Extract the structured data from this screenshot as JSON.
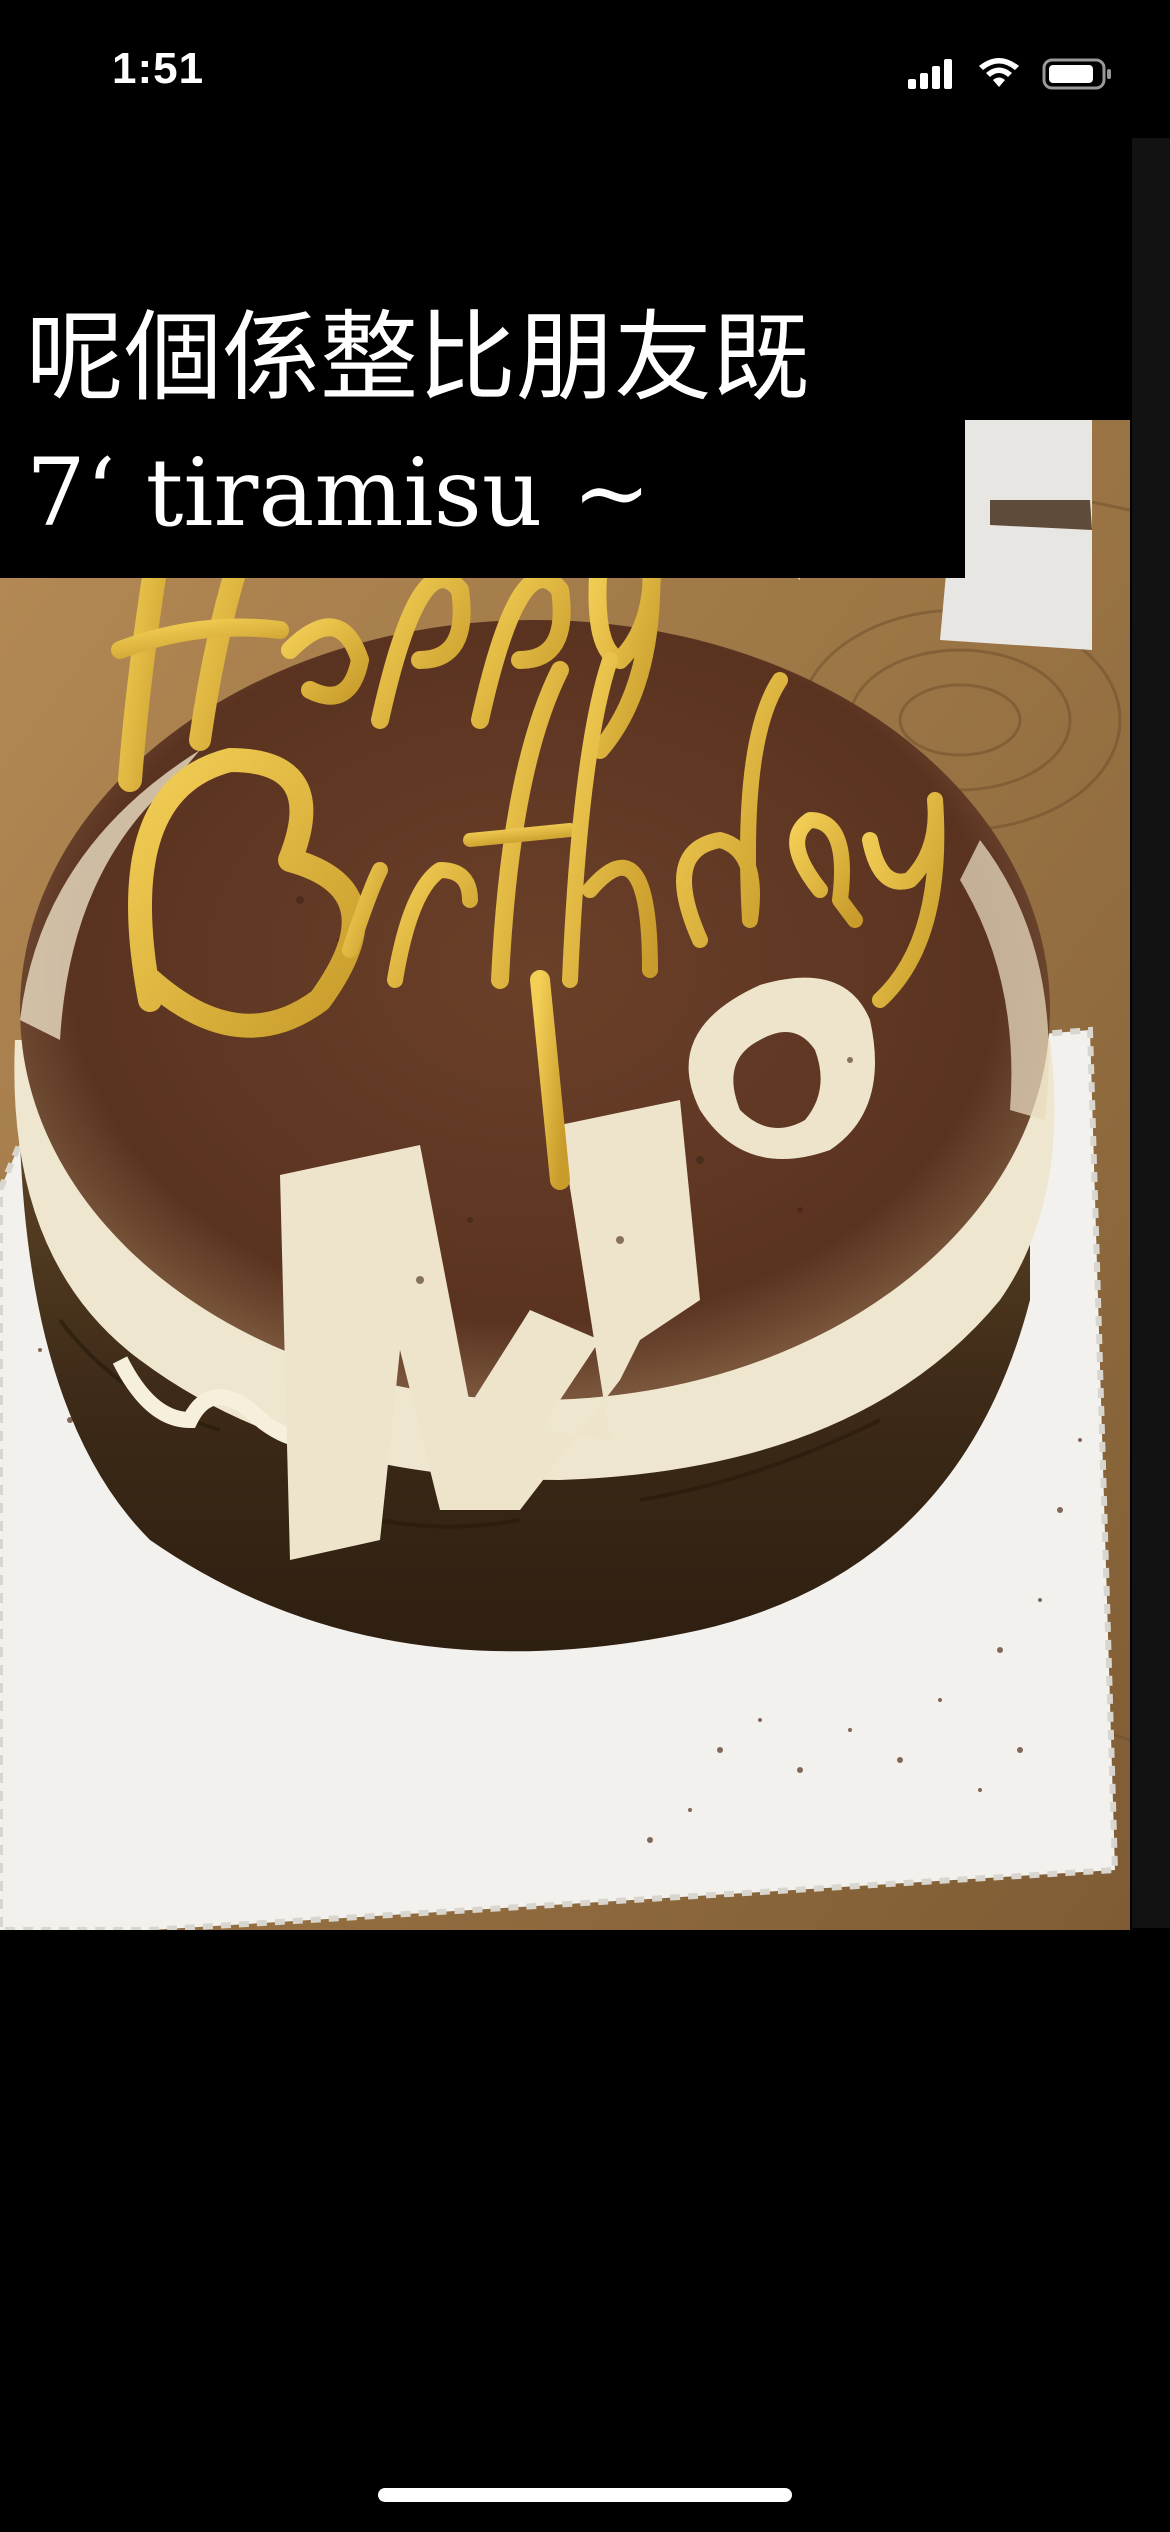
{
  "status_bar": {
    "time": "1:51",
    "icons": [
      "signal-icon",
      "wifi-icon",
      "battery-icon"
    ]
  },
  "story": {
    "caption_line_1": "呢個係整比朋友既",
    "caption_line_2": "7‘ tiramisu ~",
    "photo": {
      "subject": "tiramisu-birthday-cake",
      "topper_text": "Happy Birthday",
      "stencil_text": "MO"
    }
  },
  "colors": {
    "background": "#000000",
    "text": "#ffffff",
    "wood": "#9a7444",
    "cocoa": "#6b4029",
    "cream": "#efe6cf",
    "gold": "#d8b13a"
  }
}
